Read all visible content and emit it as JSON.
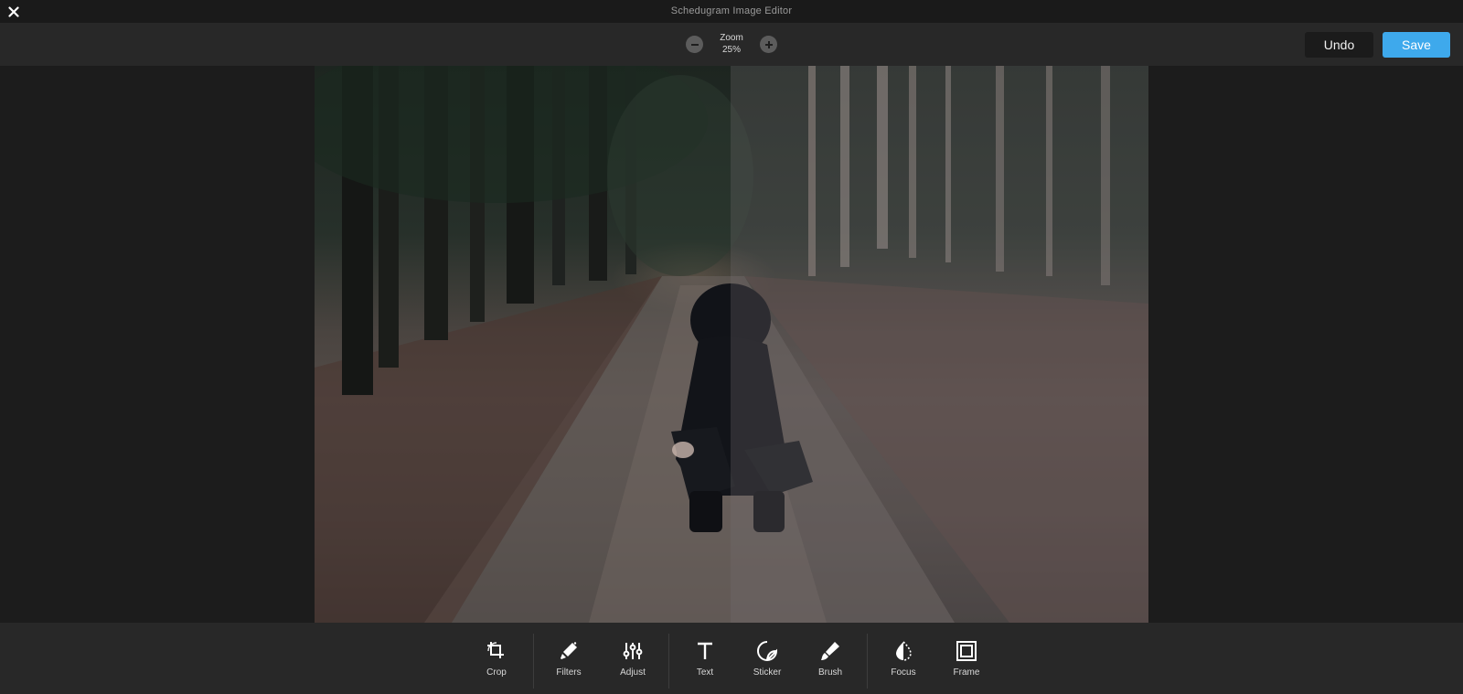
{
  "window": {
    "title": "Schedugram Image Editor",
    "close_icon": "close-icon"
  },
  "toolbar": {
    "zoom_label": "Zoom",
    "zoom_value": "25%",
    "undo_label": "Undo",
    "save_label": "Save"
  },
  "colors": {
    "accent": "#3ea9ec",
    "background": "#1c1c1c",
    "bar": "#282828"
  },
  "tools": [
    {
      "label": "Crop",
      "icon": "crop-icon"
    },
    {
      "label": "Filters",
      "icon": "filters-icon"
    },
    {
      "label": "Adjust",
      "icon": "adjust-icon"
    },
    {
      "label": "Text",
      "icon": "text-icon"
    },
    {
      "label": "Sticker",
      "icon": "sticker-icon"
    },
    {
      "label": "Brush",
      "icon": "brush-icon"
    },
    {
      "label": "Focus",
      "icon": "focus-icon"
    },
    {
      "label": "Frame",
      "icon": "frame-icon"
    }
  ]
}
